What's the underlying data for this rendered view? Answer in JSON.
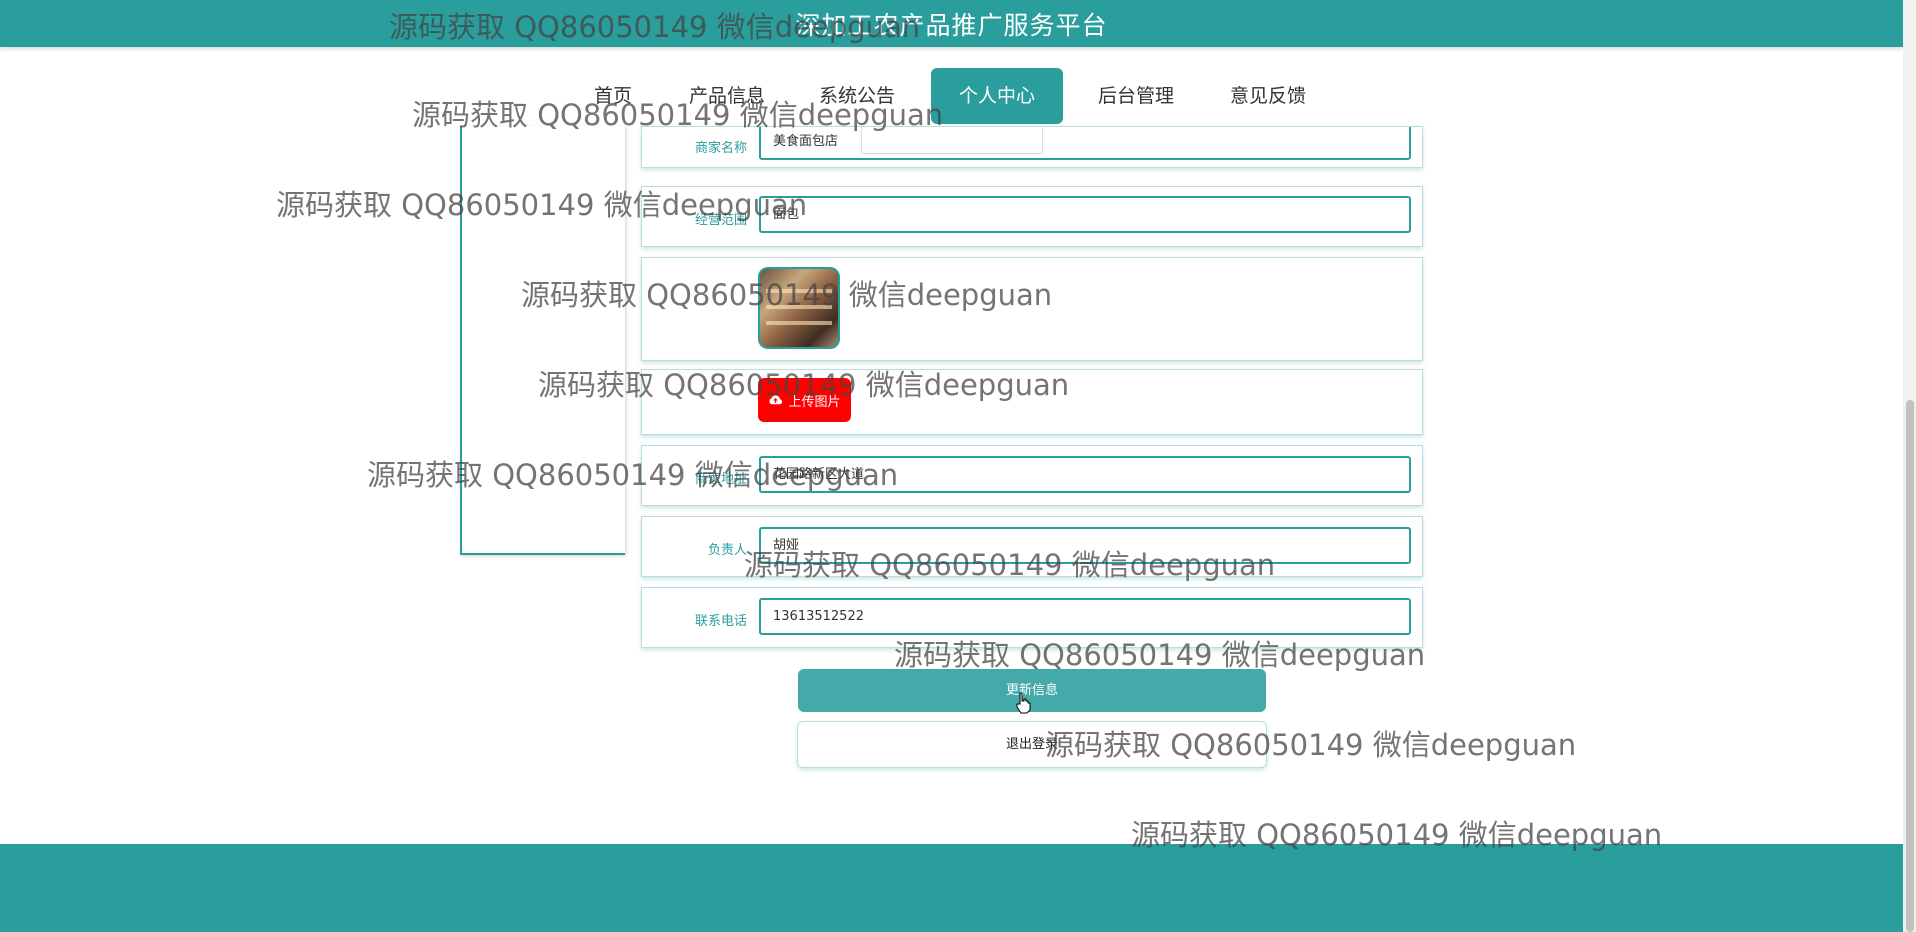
{
  "header": {
    "site_title": "深加工农产品推广服务平台"
  },
  "nav": {
    "items": [
      {
        "label": "首页"
      },
      {
        "label": "产品信息"
      },
      {
        "label": "系统公告"
      },
      {
        "label": "个人中心",
        "active": true
      },
      {
        "label": "后台管理"
      },
      {
        "label": "意见反馈"
      }
    ]
  },
  "form": {
    "shop_name": {
      "label": "商家名称",
      "value": "美食面包店"
    },
    "business_scope": {
      "label": "经营范围",
      "value": "面包"
    },
    "upload_button": "上传图片",
    "shop_address": {
      "label": "商家地址",
      "value": "花园路新区大道"
    },
    "manager": {
      "label": "负责人",
      "value": "胡娅"
    },
    "phone": {
      "label": "联系电话",
      "value": "13613512522"
    },
    "update_button": "更新信息",
    "logout_button": "退出登录"
  },
  "watermark": {
    "text": "源码获取 QQ86050149 微信deepguan"
  },
  "colors": {
    "primary": "#2a9d9d",
    "upload": "#ff0000",
    "update_button": "#44a9a9"
  }
}
